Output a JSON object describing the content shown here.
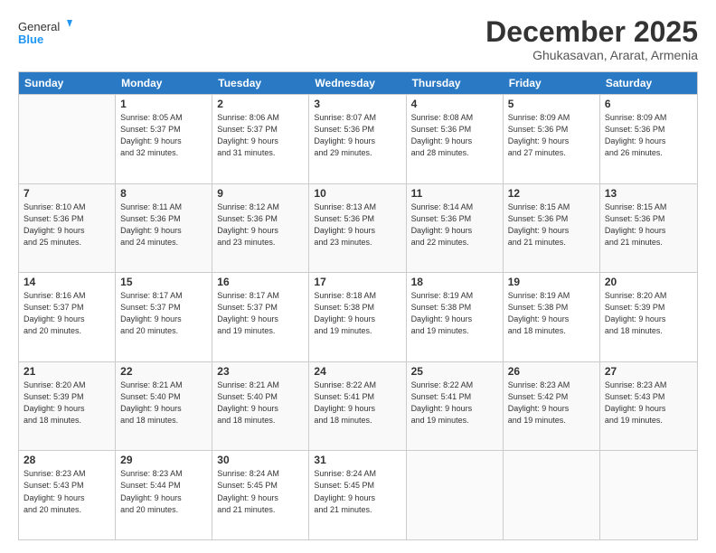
{
  "header": {
    "logo_general": "General",
    "logo_blue": "Blue",
    "month": "December 2025",
    "location": "Ghukasavan, Ararat, Armenia"
  },
  "weekdays": [
    "Sunday",
    "Monday",
    "Tuesday",
    "Wednesday",
    "Thursday",
    "Friday",
    "Saturday"
  ],
  "rows": [
    [
      {
        "day": "",
        "info": ""
      },
      {
        "day": "1",
        "info": "Sunrise: 8:05 AM\nSunset: 5:37 PM\nDaylight: 9 hours\nand 32 minutes."
      },
      {
        "day": "2",
        "info": "Sunrise: 8:06 AM\nSunset: 5:37 PM\nDaylight: 9 hours\nand 31 minutes."
      },
      {
        "day": "3",
        "info": "Sunrise: 8:07 AM\nSunset: 5:36 PM\nDaylight: 9 hours\nand 29 minutes."
      },
      {
        "day": "4",
        "info": "Sunrise: 8:08 AM\nSunset: 5:36 PM\nDaylight: 9 hours\nand 28 minutes."
      },
      {
        "day": "5",
        "info": "Sunrise: 8:09 AM\nSunset: 5:36 PM\nDaylight: 9 hours\nand 27 minutes."
      },
      {
        "day": "6",
        "info": "Sunrise: 8:09 AM\nSunset: 5:36 PM\nDaylight: 9 hours\nand 26 minutes."
      }
    ],
    [
      {
        "day": "7",
        "info": "Sunrise: 8:10 AM\nSunset: 5:36 PM\nDaylight: 9 hours\nand 25 minutes."
      },
      {
        "day": "8",
        "info": "Sunrise: 8:11 AM\nSunset: 5:36 PM\nDaylight: 9 hours\nand 24 minutes."
      },
      {
        "day": "9",
        "info": "Sunrise: 8:12 AM\nSunset: 5:36 PM\nDaylight: 9 hours\nand 23 minutes."
      },
      {
        "day": "10",
        "info": "Sunrise: 8:13 AM\nSunset: 5:36 PM\nDaylight: 9 hours\nand 23 minutes."
      },
      {
        "day": "11",
        "info": "Sunrise: 8:14 AM\nSunset: 5:36 PM\nDaylight: 9 hours\nand 22 minutes."
      },
      {
        "day": "12",
        "info": "Sunrise: 8:15 AM\nSunset: 5:36 PM\nDaylight: 9 hours\nand 21 minutes."
      },
      {
        "day": "13",
        "info": "Sunrise: 8:15 AM\nSunset: 5:36 PM\nDaylight: 9 hours\nand 21 minutes."
      }
    ],
    [
      {
        "day": "14",
        "info": "Sunrise: 8:16 AM\nSunset: 5:37 PM\nDaylight: 9 hours\nand 20 minutes."
      },
      {
        "day": "15",
        "info": "Sunrise: 8:17 AM\nSunset: 5:37 PM\nDaylight: 9 hours\nand 20 minutes."
      },
      {
        "day": "16",
        "info": "Sunrise: 8:17 AM\nSunset: 5:37 PM\nDaylight: 9 hours\nand 19 minutes."
      },
      {
        "day": "17",
        "info": "Sunrise: 8:18 AM\nSunset: 5:38 PM\nDaylight: 9 hours\nand 19 minutes."
      },
      {
        "day": "18",
        "info": "Sunrise: 8:19 AM\nSunset: 5:38 PM\nDaylight: 9 hours\nand 19 minutes."
      },
      {
        "day": "19",
        "info": "Sunrise: 8:19 AM\nSunset: 5:38 PM\nDaylight: 9 hours\nand 18 minutes."
      },
      {
        "day": "20",
        "info": "Sunrise: 8:20 AM\nSunset: 5:39 PM\nDaylight: 9 hours\nand 18 minutes."
      }
    ],
    [
      {
        "day": "21",
        "info": "Sunrise: 8:20 AM\nSunset: 5:39 PM\nDaylight: 9 hours\nand 18 minutes."
      },
      {
        "day": "22",
        "info": "Sunrise: 8:21 AM\nSunset: 5:40 PM\nDaylight: 9 hours\nand 18 minutes."
      },
      {
        "day": "23",
        "info": "Sunrise: 8:21 AM\nSunset: 5:40 PM\nDaylight: 9 hours\nand 18 minutes."
      },
      {
        "day": "24",
        "info": "Sunrise: 8:22 AM\nSunset: 5:41 PM\nDaylight: 9 hours\nand 18 minutes."
      },
      {
        "day": "25",
        "info": "Sunrise: 8:22 AM\nSunset: 5:41 PM\nDaylight: 9 hours\nand 19 minutes."
      },
      {
        "day": "26",
        "info": "Sunrise: 8:23 AM\nSunset: 5:42 PM\nDaylight: 9 hours\nand 19 minutes."
      },
      {
        "day": "27",
        "info": "Sunrise: 8:23 AM\nSunset: 5:43 PM\nDaylight: 9 hours\nand 19 minutes."
      }
    ],
    [
      {
        "day": "28",
        "info": "Sunrise: 8:23 AM\nSunset: 5:43 PM\nDaylight: 9 hours\nand 20 minutes."
      },
      {
        "day": "29",
        "info": "Sunrise: 8:23 AM\nSunset: 5:44 PM\nDaylight: 9 hours\nand 20 minutes."
      },
      {
        "day": "30",
        "info": "Sunrise: 8:24 AM\nSunset: 5:45 PM\nDaylight: 9 hours\nand 21 minutes."
      },
      {
        "day": "31",
        "info": "Sunrise: 8:24 AM\nSunset: 5:45 PM\nDaylight: 9 hours\nand 21 minutes."
      },
      {
        "day": "",
        "info": ""
      },
      {
        "day": "",
        "info": ""
      },
      {
        "day": "",
        "info": ""
      }
    ]
  ]
}
